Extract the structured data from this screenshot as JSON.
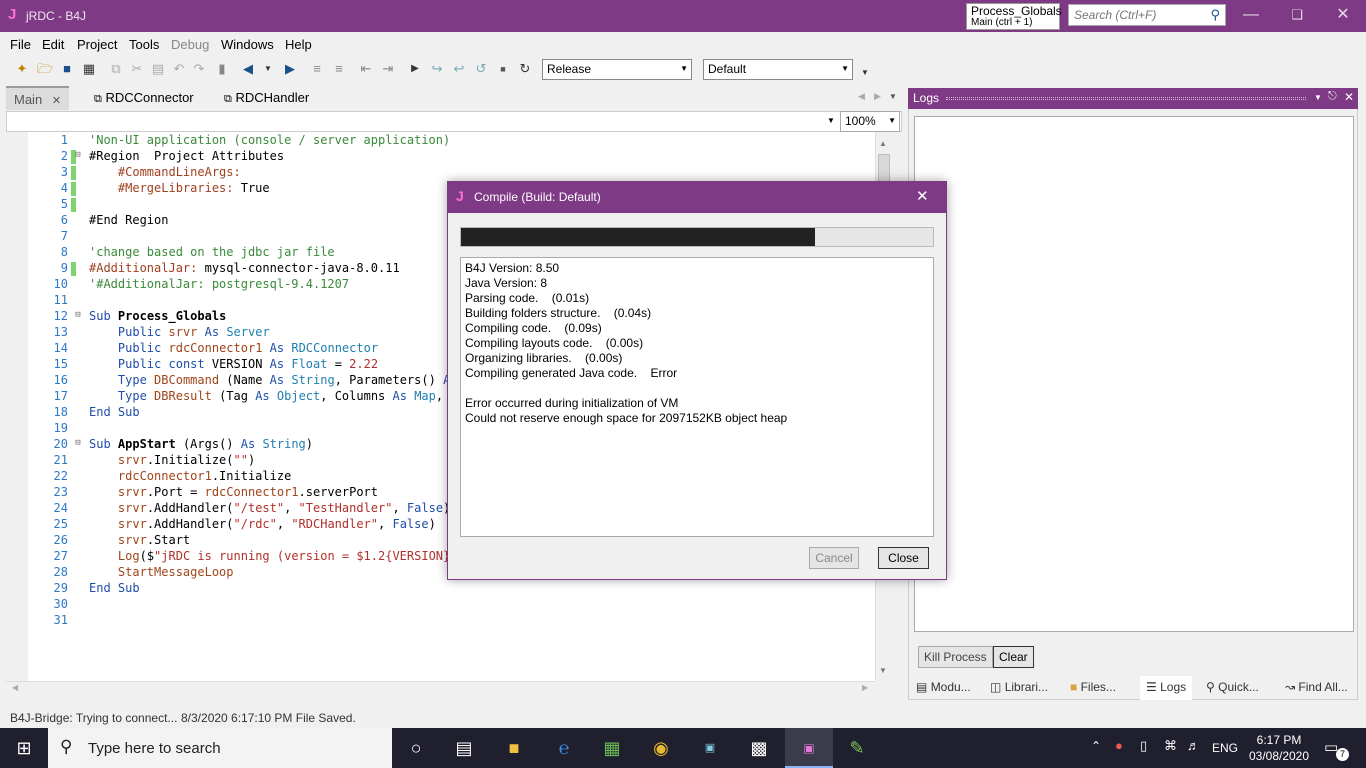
{
  "window": {
    "title": "jRDC - B4J",
    "app_icon": "J",
    "process_box": {
      "line1": "Process_Globals",
      "line2": "Main  (ctrl + 1)"
    },
    "search_placeholder": "Search (Ctrl+F)"
  },
  "menu": [
    "File",
    "Edit",
    "Project",
    "Tools",
    "Debug",
    "Windows",
    "Help"
  ],
  "toolbar": {
    "build_config": "Release",
    "device": "Default"
  },
  "tabs": [
    {
      "label": "Main"
    },
    {
      "label": "RDCConnector"
    },
    {
      "label": "RDCHandler"
    }
  ],
  "editor": {
    "zoom": "100%",
    "line_numbers": [
      "1",
      "2",
      "3",
      "4",
      "5",
      "6",
      "7",
      "8",
      "9",
      "10",
      "11",
      "12",
      "13",
      "14",
      "15",
      "16",
      "17",
      "18",
      "19",
      "20",
      "21",
      "22",
      "23",
      "24",
      "25",
      "26",
      "27",
      "28",
      "29",
      "30",
      "31"
    ],
    "lines": [
      "'Non-UI application (console / server application)",
      "#Region  Project Attributes",
      "    #CommandLineArgs:",
      "    #MergeLibraries: True",
      "",
      "#End Region",
      "",
      "'change based on the jdbc jar file",
      "#AdditionalJar: mysql-connector-java-8.0.11",
      "'#AdditionalJar: postgresql-9.4.1207",
      "",
      "Sub Process_Globals",
      "    Public srvr As Server",
      "    Public rdcConnector1 As RDCConnector",
      "    Public const VERSION As Float = 2.22",
      "    Type DBCommand (Name As String, Parameters() As",
      "    Type DBResult (Tag As Object, Columns As Map, R",
      "End Sub",
      "",
      "Sub AppStart (Args() As String)",
      "    srvr.Initialize(\"\")",
      "    rdcConnector1.Initialize",
      "    srvr.Port = rdcConnector1.serverPort",
      "    srvr.AddHandler(\"/test\", \"TestHandler\", False)",
      "    srvr.AddHandler(\"/rdc\", \"RDCHandler\", False)",
      "    srvr.Start",
      "    Log($\"jRDC is running (version = $1.2{VERSION})",
      "    StartMessageLoop",
      "End Sub",
      "",
      ""
    ]
  },
  "logs": {
    "title": "Logs",
    "kill_label": "Kill Process",
    "clear_label": "Clear",
    "bottom_tabs": [
      "Modu...",
      "Librari...",
      "Files...",
      "Logs",
      "Quick...",
      "Find All..."
    ]
  },
  "status": {
    "bridge": "B4J-Bridge: Trying to connect...",
    "saved": "8/3/2020 6:17:10 PM  File Saved."
  },
  "dialog": {
    "title": "Compile (Build: Default)",
    "progress": 0.75,
    "output": [
      "B4J Version: 8.50",
      "Java Version: 8",
      "Parsing code.    (0.01s)",
      "Building folders structure.    (0.04s)",
      "Compiling code.    (0.09s)",
      "Compiling layouts code.    (0.00s)",
      "Organizing libraries.    (0.00s)",
      "Compiling generated Java code.    Error",
      "",
      "Error occurred during initialization of VM",
      "Could not reserve enough space for 2097152KB object heap"
    ],
    "cancel_label": "Cancel",
    "close_label": "Close"
  },
  "taskbar": {
    "search_placeholder": "Type here to search",
    "lang": "ENG",
    "time": "6:17 PM",
    "date": "03/08/2020",
    "notif_count": "7"
  }
}
